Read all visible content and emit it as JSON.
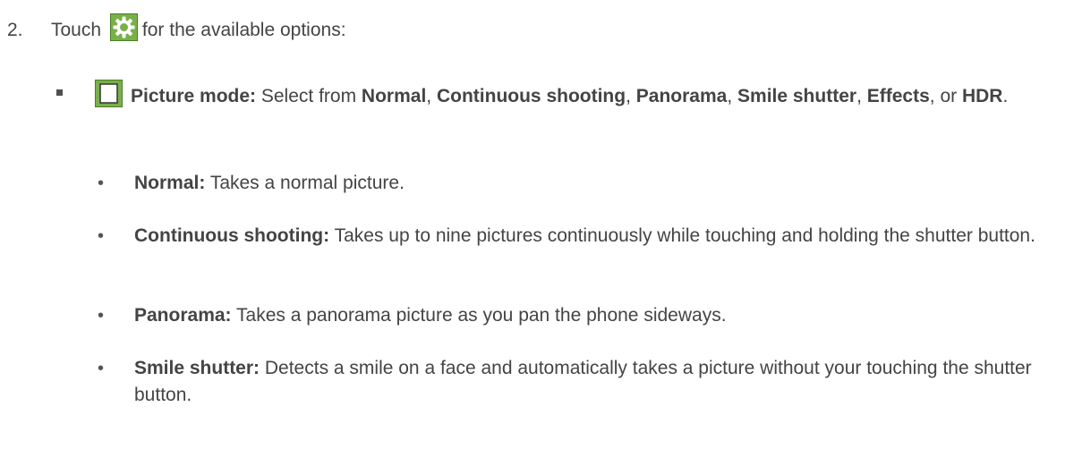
{
  "step": {
    "number": "2.",
    "before_icon": "Touch",
    "icon": "gear-icon",
    "after_icon": "for the available options:"
  },
  "picture_mode": {
    "icon": "picture-mode-icon",
    "label": "Picture mode:",
    "intro": "Select from",
    "option_1": "Normal",
    "sep_1": ",",
    "option_2": "Continuous shooting",
    "sep_2": ",",
    "option_3": "Panorama",
    "sep_3": ",",
    "option_4": "Smile shutter",
    "sep_4": ",",
    "option_5": "Effects",
    "sep_5": ", or",
    "option_6": "HDR",
    "end": "."
  },
  "options": [
    {
      "bullet": "•",
      "label": "Normal:",
      "description": "Takes a normal picture."
    },
    {
      "bullet": "•",
      "label": "Continuous shooting:",
      "description": "Takes up to nine pictures continuously while touching and holding the shutter button."
    },
    {
      "bullet": "•",
      "label": "Panorama:",
      "description": "Takes a panorama picture as you pan the phone sideways."
    },
    {
      "bullet": "•",
      "label": "Smile shutter:",
      "description": "Detects a smile on a face and automatically takes a picture without your touching the shutter button."
    }
  ],
  "colors": {
    "text": "#444444",
    "icon_background": "#79b04a",
    "icon_border": "#4a7e27"
  }
}
